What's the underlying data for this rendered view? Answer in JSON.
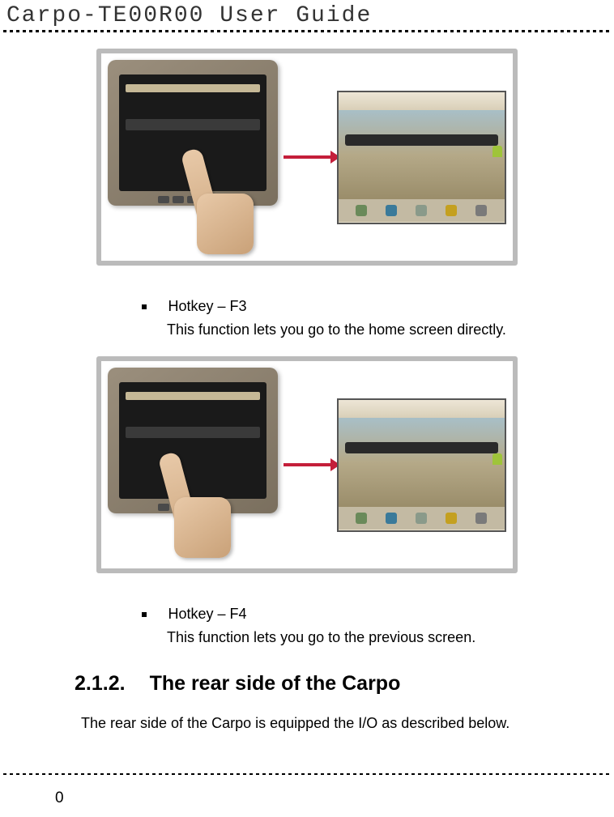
{
  "header": {
    "title": "Carpo-TE00R00  User  Guide"
  },
  "hotkeys": [
    {
      "label": "Hotkey – F3",
      "description": "This function lets you go to the home screen directly."
    },
    {
      "label": "Hotkey – F4",
      "description": "This function lets you go to the previous screen."
    }
  ],
  "section": {
    "number": "2.1.2.",
    "title": "The rear side of the Carpo",
    "body": "The rear side of the Carpo is equipped the I/O as described below."
  },
  "footer": {
    "page": "0"
  }
}
